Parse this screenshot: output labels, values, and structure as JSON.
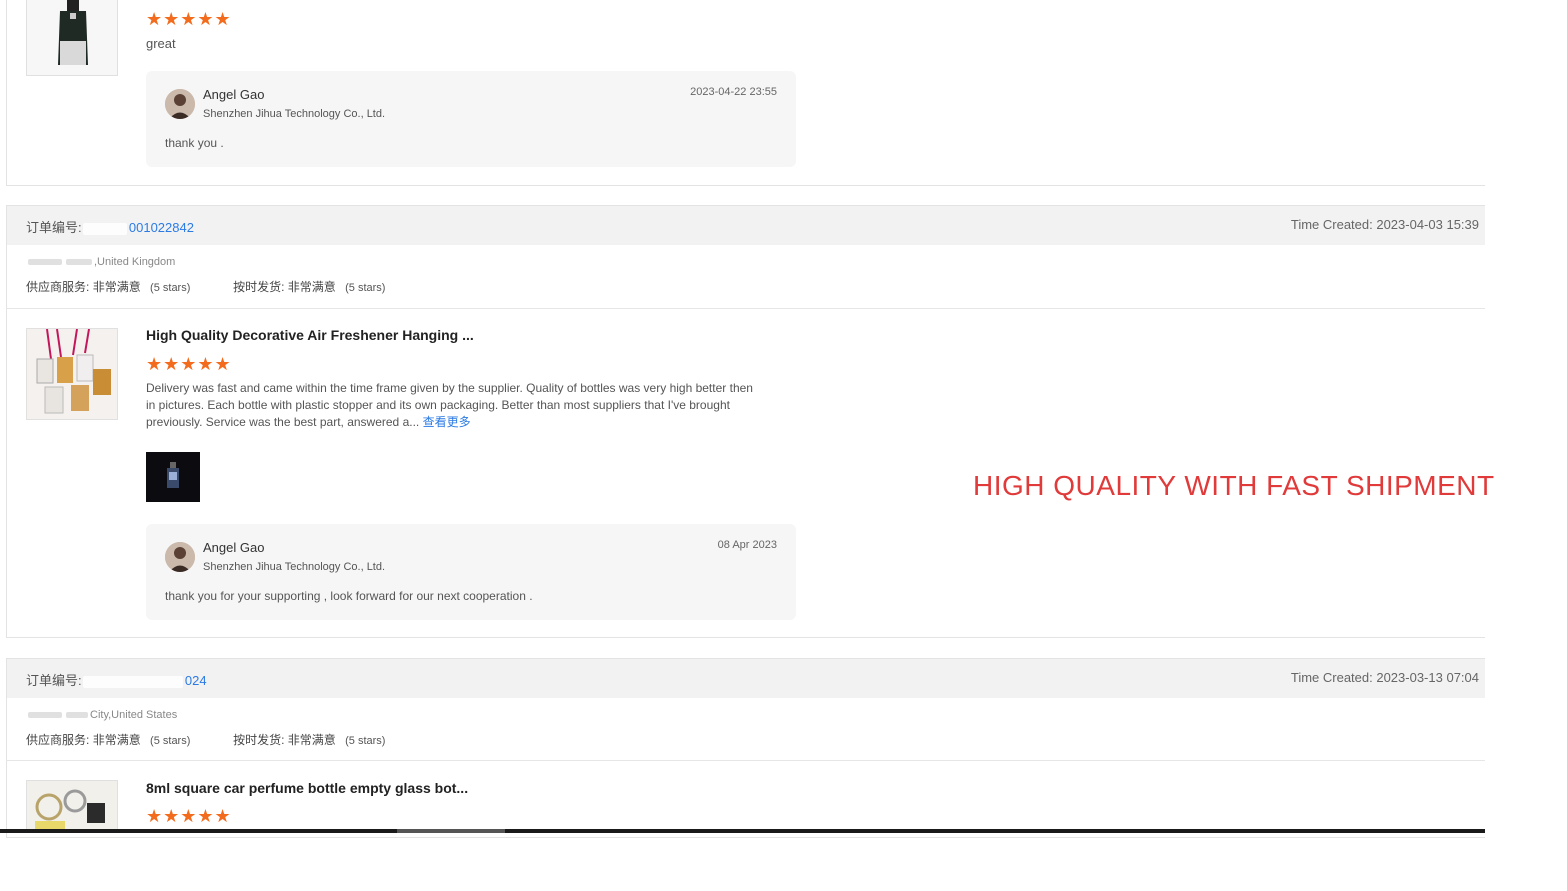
{
  "review1": {
    "stars": "★★★★★",
    "text": "great",
    "reply": {
      "name": "Angel Gao",
      "company": "Shenzhen Jihua Technology Co., Ltd.",
      "date": "2023-04-22 23:55",
      "text": "thank you ."
    }
  },
  "order2": {
    "label": "订单编号:",
    "number_visible": "001022842",
    "time_created": "Time Created: 2023-04-03 15:39",
    "location": ",United Kingdom",
    "service_label": "供应商服务:",
    "service_value": "非常满意",
    "service_stars": "(5 stars)",
    "shipping_label": "按时发货:",
    "shipping_value": "非常满意",
    "shipping_stars": "(5 stars)",
    "product_title": "High Quality Decorative Air Freshener Hanging ...",
    "stars": "★★★★★",
    "review_text": "Delivery was fast and came within the time frame given by the supplier. Quality of bottles was very high better then in pictures. Each bottle with plastic stopper and its own packaging. Better than most suppliers that I've brought previously. Service was the best part, answered a...",
    "see_more": "查看更多",
    "reply": {
      "name": "Angel Gao",
      "company": "Shenzhen Jihua Technology Co., Ltd.",
      "date": "08 Apr 2023",
      "text": "thank you for your supporting , look forward for our next cooperation ."
    }
  },
  "overlay": {
    "text": "HIGH QUALITY WITH FAST SHIPMENT",
    "color": "#e03a3a"
  },
  "order3": {
    "label": "订单编号:",
    "number_visible": "024",
    "time_created": "Time Created: 2023-03-13 07:04",
    "location": "City,United States",
    "service_label": "供应商服务:",
    "service_value": "非常满意",
    "service_stars": "(5 stars)",
    "shipping_label": "按时发货:",
    "shipping_value": "非常满意",
    "shipping_stars": "(5 stars)",
    "product_title": "8ml square car perfume bottle empty glass bot...",
    "stars": "★★★★★"
  },
  "colors": {
    "star": "#f36b1c",
    "link": "#2c7be5",
    "header_bg": "#f2f2f2"
  }
}
